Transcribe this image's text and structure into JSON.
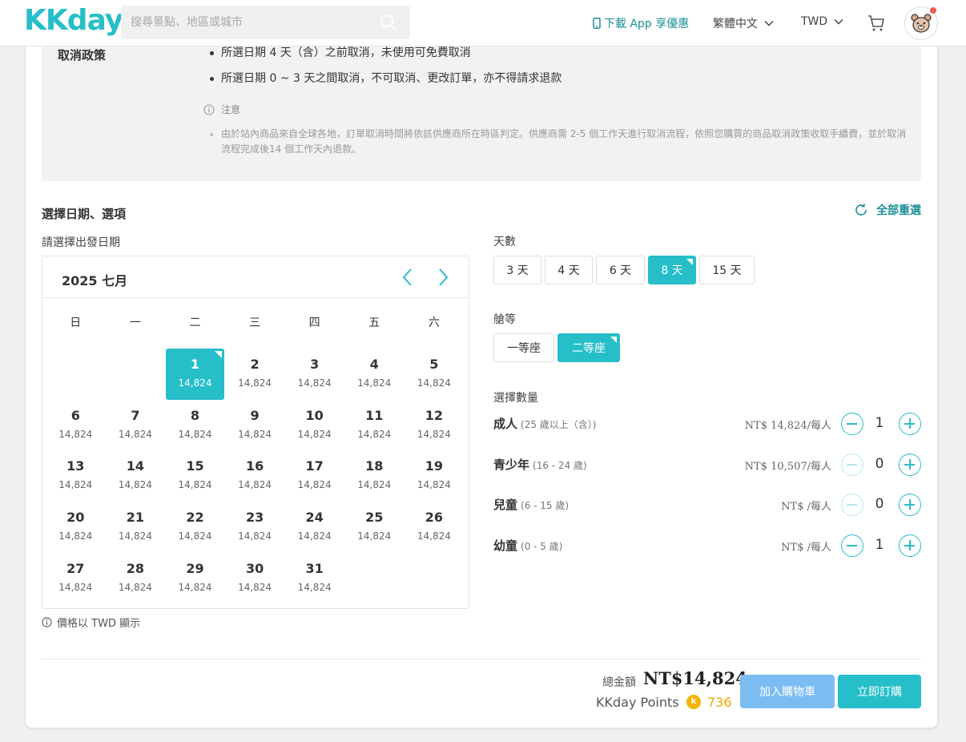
{
  "header": {
    "logo": "KKday",
    "search_placeholder": "搜尋景點、地區或城市",
    "app_link": "下載 App 享優惠",
    "language": "繁體中文",
    "currency": "TWD"
  },
  "policy": {
    "title": "取消政策",
    "rules": [
      "所選日期 4 天（含）之前取消，未使用可免費取消",
      "所選日期 0 ~ 3 天之間取消，不可取消、更改訂單，亦不得請求退款"
    ],
    "note_title": "注意",
    "note_text": "由於站內商品來自全球各地，訂單取消時間將依該供應商所在時區判定。供應商需 2-5 個工作天進行取消流程，依照您購買的商品取消政策收取手續費，並於取消流程完成後14 個工作天內退款。"
  },
  "selection": {
    "title": "選擇日期、選項",
    "reset": "全部重選",
    "date_label": "請選擇出發日期",
    "price_note": "價格以 TWD 顯示"
  },
  "calendar": {
    "month": "2025 七月",
    "weekdays": [
      "日",
      "一",
      "二",
      "三",
      "四",
      "五",
      "六"
    ],
    "leading_empty": 2,
    "selected_day": "1",
    "days": [
      {
        "d": "1",
        "p": "14,824"
      },
      {
        "d": "2",
        "p": "14,824"
      },
      {
        "d": "3",
        "p": "14,824"
      },
      {
        "d": "4",
        "p": "14,824"
      },
      {
        "d": "5",
        "p": "14,824"
      },
      {
        "d": "6",
        "p": "14,824"
      },
      {
        "d": "7",
        "p": "14,824"
      },
      {
        "d": "8",
        "p": "14,824"
      },
      {
        "d": "9",
        "p": "14,824"
      },
      {
        "d": "10",
        "p": "14,824"
      },
      {
        "d": "11",
        "p": "14,824"
      },
      {
        "d": "12",
        "p": "14,824"
      },
      {
        "d": "13",
        "p": "14,824"
      },
      {
        "d": "14",
        "p": "14,824"
      },
      {
        "d": "15",
        "p": "14,824"
      },
      {
        "d": "16",
        "p": "14,824"
      },
      {
        "d": "17",
        "p": "14,824"
      },
      {
        "d": "18",
        "p": "14,824"
      },
      {
        "d": "19",
        "p": "14,824"
      },
      {
        "d": "20",
        "p": "14,824"
      },
      {
        "d": "21",
        "p": "14,824"
      },
      {
        "d": "22",
        "p": "14,824"
      },
      {
        "d": "23",
        "p": "14,824"
      },
      {
        "d": "24",
        "p": "14,824"
      },
      {
        "d": "25",
        "p": "14,824"
      },
      {
        "d": "26",
        "p": "14,824"
      },
      {
        "d": "27",
        "p": "14,824"
      },
      {
        "d": "28",
        "p": "14,824"
      },
      {
        "d": "29",
        "p": "14,824"
      },
      {
        "d": "30",
        "p": "14,824"
      },
      {
        "d": "31",
        "p": "14,824"
      }
    ]
  },
  "duration": {
    "label": "天數",
    "options": [
      "3 天",
      "4 天",
      "6 天",
      "8 天",
      "15 天"
    ],
    "selected": "8 天"
  },
  "seat_class": {
    "label": "艙等",
    "options": [
      "一等座",
      "二等座"
    ],
    "selected": "二等座"
  },
  "quantity": {
    "label": "選擇數量",
    "rows": [
      {
        "name": "成人",
        "range": "(25 歲以上（含）)",
        "price": "NT$ 14,824/每人",
        "value": "1",
        "minus_enabled": true
      },
      {
        "name": "青少年",
        "range": "(16 - 24 歲)",
        "price": "NT$ 10,507/每人",
        "value": "0",
        "minus_enabled": false
      },
      {
        "name": "兒童",
        "range": "(6 - 15 歲)",
        "price": "NT$ /每人",
        "value": "0",
        "minus_enabled": false
      },
      {
        "name": "幼童",
        "range": "(0 - 5 歲)",
        "price": "NT$ /每人",
        "value": "1",
        "minus_enabled": true
      }
    ]
  },
  "footer": {
    "total_label": "總金額",
    "total_value": "NT$14,824",
    "points_label": "KKday Points",
    "points_icon": "k",
    "points_value": "736",
    "add_to_cart": "加入購物車",
    "book_now": "立即訂購"
  },
  "colors": {
    "accent": "#26bec9",
    "accent_text": "#1c8f98",
    "cart_button": "#7bbdf3",
    "points": "#f0a500"
  }
}
